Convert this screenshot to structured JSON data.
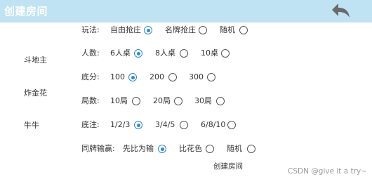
{
  "header": {
    "title": "创建房间",
    "back_icon": "back-arrow-icon",
    "background": "#bfe3f2"
  },
  "games": [
    "斗地主",
    "炸金花",
    "牛牛"
  ],
  "rows": {
    "mode": {
      "label": "玩法:",
      "options": [
        "自由抢庄",
        "名牌抢庄",
        "随机"
      ],
      "selected": 0
    },
    "players": {
      "label": "人数:",
      "options": [
        "6人桌",
        "8人桌",
        "10桌"
      ],
      "selected": 0
    },
    "base": {
      "label": "底分:",
      "options": [
        "100",
        "200",
        "300"
      ],
      "selected": 0
    },
    "rounds": {
      "label": "局数:",
      "options": [
        "10局",
        "20局",
        "30局"
      ],
      "selected": -1
    },
    "bet": {
      "label": "底注:",
      "options": [
        "1/2/3",
        "3/4/5",
        "6/8/10"
      ],
      "selected": 0
    },
    "tie": {
      "label": "同牌输赢:",
      "options": [
        "先比为输",
        "比花色",
        "随机"
      ],
      "selected": 0
    }
  },
  "create_button": "创建房间",
  "watermark": "CSDN @give it a try~",
  "accent_color": "#2c88d9"
}
